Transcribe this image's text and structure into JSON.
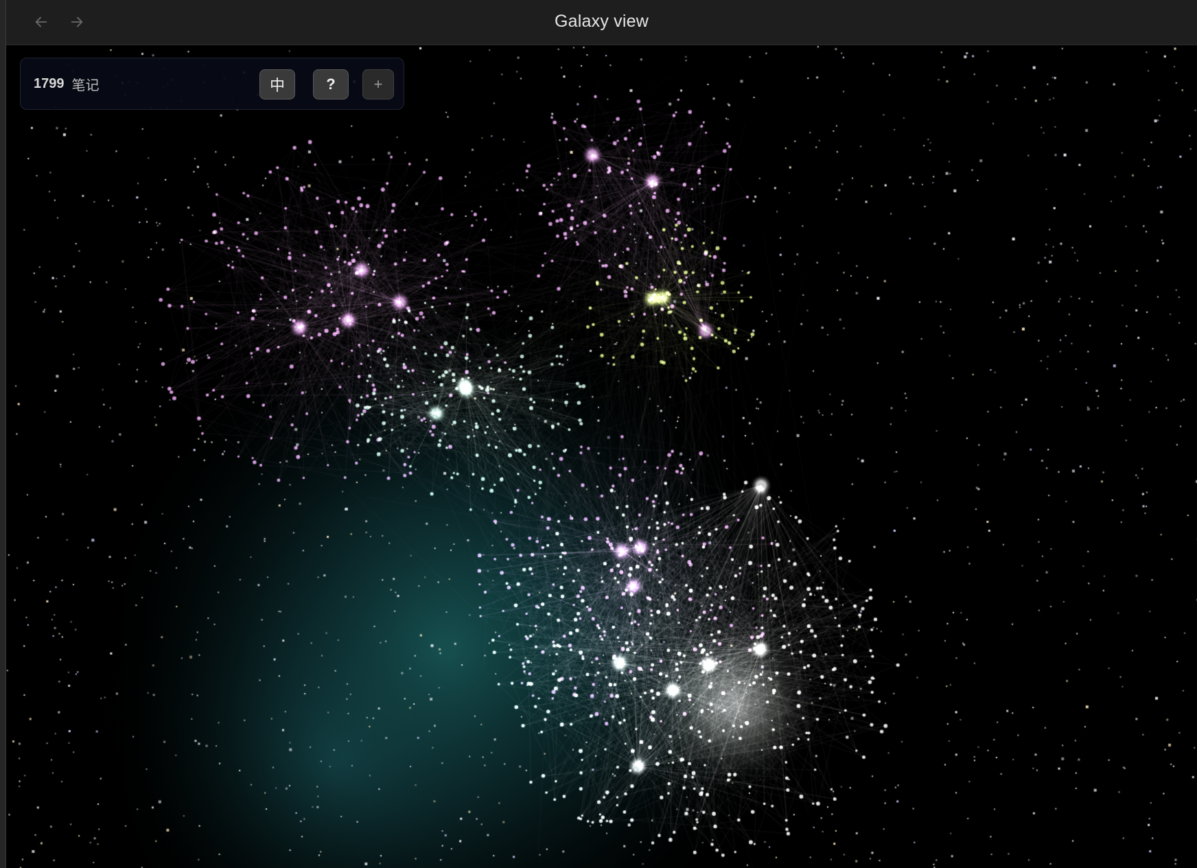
{
  "titlebar": {
    "title": "Galaxy view",
    "back_icon": "arrow-left-icon",
    "forward_icon": "arrow-right-icon"
  },
  "panel": {
    "note_count": "1799",
    "note_unit": "笔记",
    "buttons": {
      "language": "中",
      "help": "?",
      "add": "+"
    }
  },
  "graph": {
    "colors": {
      "background": "#000000",
      "pink": "#e7a7ee",
      "yellow_green": "#d8ef8a",
      "mint": "#cfeee0",
      "white": "#ffffff",
      "teal_glow": "#1c5f5f"
    }
  }
}
